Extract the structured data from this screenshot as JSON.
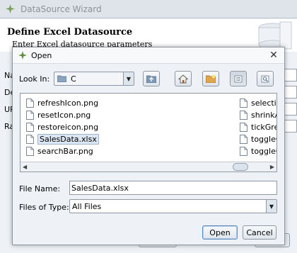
{
  "wizard": {
    "title": "DataSource Wizard",
    "header_title": "Define Excel Datasource",
    "header_subtitle": "Enter Excel datasource parameters",
    "side_labels": [
      "Na",
      "De",
      "UR",
      "Ra"
    ]
  },
  "dialog": {
    "title": "Open",
    "look_in_label": "Look In:",
    "look_in_value": "C",
    "files_left": [
      "refreshIcon.png",
      "resetIcon.png",
      "restoreicon.png",
      "SalesData.xlsx",
      "searchBar.png"
    ],
    "files_right": [
      "selection",
      "shrinkAlt",
      "tickGrey(",
      "toggleOf",
      "toggleOn"
    ],
    "selected_file": "SalesData.xlsx",
    "file_name_label": "File Name:",
    "file_name_value": "SalesData.xlsx",
    "files_of_type_label": "Files of Type:",
    "files_of_type_value": "All Files",
    "open_button": "Open",
    "cancel_button": "Cancel",
    "toolbar_icons": [
      "up-one-level-icon",
      "home-icon",
      "new-folder-icon",
      "list-view-icon",
      "details-view-icon"
    ]
  },
  "colors": {
    "selection": "#dbe6f2",
    "default_button_border": "#5f8dbf",
    "wizard_bg": "#eef1f5"
  }
}
